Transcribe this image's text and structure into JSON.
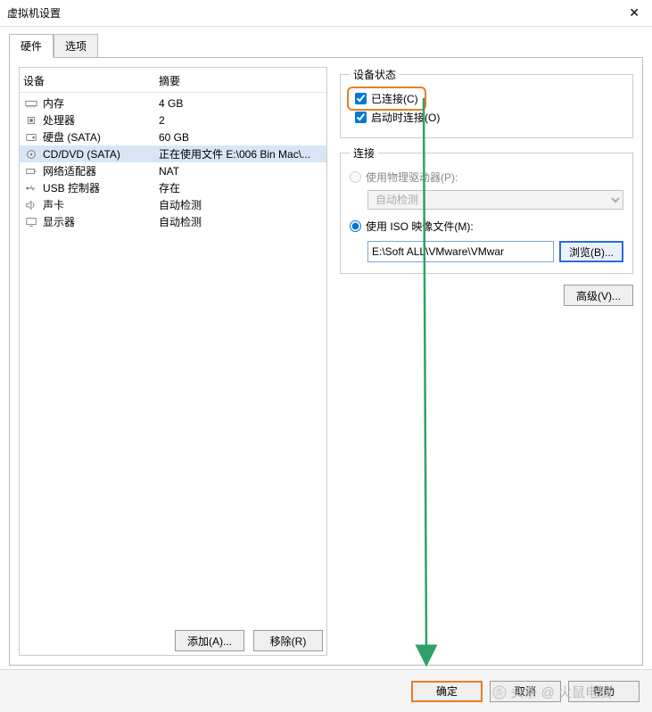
{
  "window": {
    "title": "虚拟机设置",
    "close_glyph": "✕"
  },
  "tabs": {
    "hardware": "硬件",
    "options": "选项"
  },
  "device_table": {
    "col_device": "设备",
    "col_summary": "摘要"
  },
  "devices": [
    {
      "icon": "memory-icon",
      "name": "内存",
      "summary": "4 GB"
    },
    {
      "icon": "cpu-icon",
      "name": "处理器",
      "summary": "2"
    },
    {
      "icon": "disk-icon",
      "name": "硬盘 (SATA)",
      "summary": "60 GB"
    },
    {
      "icon": "cd-icon",
      "name": "CD/DVD (SATA)",
      "summary": "正在使用文件 E:\\006 Bin Mac\\..."
    },
    {
      "icon": "network-icon",
      "name": "网络适配器",
      "summary": "NAT"
    },
    {
      "icon": "usb-icon",
      "name": "USB 控制器",
      "summary": "存在"
    },
    {
      "icon": "sound-icon",
      "name": "声卡",
      "summary": "自动检测"
    },
    {
      "icon": "display-icon",
      "name": "显示器",
      "summary": "自动检测"
    }
  ],
  "selected_device_index": 3,
  "left_buttons": {
    "add": "添加(A)...",
    "remove": "移除(R)"
  },
  "status_group": {
    "legend": "设备状态",
    "connected": "已连接(C)",
    "connect_at_power_on": "启动时连接(O)",
    "connected_checked": true,
    "connect_at_power_on_checked": true
  },
  "connection_group": {
    "legend": "连接",
    "use_physical": "使用物理驱动器(P):",
    "physical_combo_value": "自动检测",
    "use_iso": "使用 ISO 映像文件(M):",
    "iso_path": "E:\\Soft ALL\\VMware\\VMwar",
    "browse": "浏览(B)...",
    "selected": "iso"
  },
  "advanced": "高级(V)...",
  "dialog_buttons": {
    "ok": "确定",
    "cancel": "取消",
    "help": "帮助"
  },
  "watermark": "头条 @ 火鼠电脑"
}
